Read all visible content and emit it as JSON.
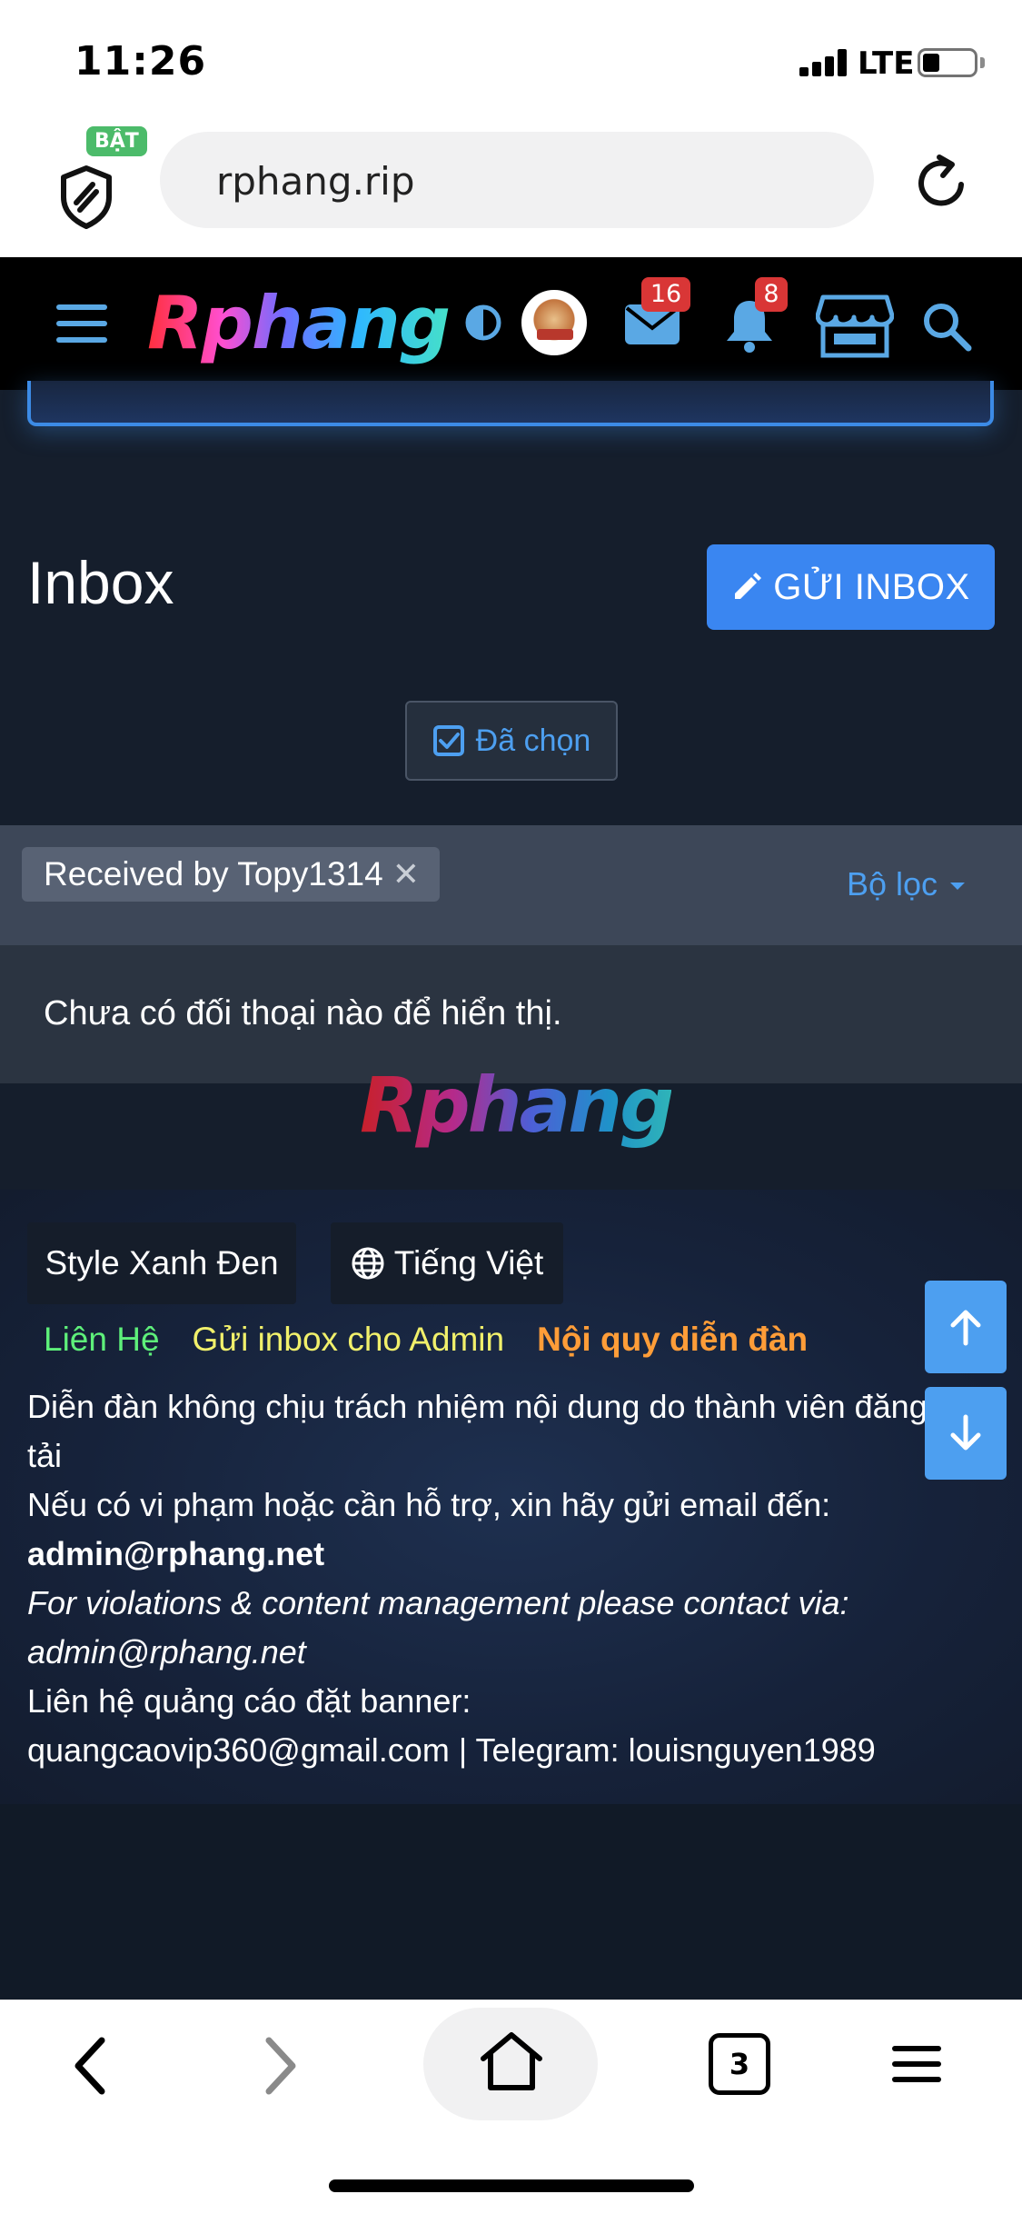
{
  "status_bar": {
    "time": "11:26",
    "network": "LTE"
  },
  "browser": {
    "shield_badge": "BẬT",
    "url": "rphang.rip",
    "tab_count": "3"
  },
  "site_header": {
    "logo_text": "Rphang",
    "mail_count": "16",
    "notification_count": "8"
  },
  "main": {
    "title": "Inbox",
    "send_button_label": "GỬI INBOX",
    "selected_button_label": "Đã chọn",
    "filter_chip_label": "Received by Topy1314",
    "filter_dropdown_label": "Bộ lọc",
    "empty_message": "Chưa có đối thoại nào để hiển thị.",
    "footer_logo_text": "Rphang"
  },
  "footer": {
    "style_label": "Style Xanh Đen",
    "language_label": "Tiếng Việt",
    "link_contact": "Liên Hệ",
    "link_admin": "Gửi inbox cho Admin",
    "link_rules": "Nội quy diễn đàn",
    "line1": "Diễn đàn không chịu trách nhiệm nội dung do thành viên đăng tải",
    "line2": "Nếu có vi phạm hoặc cần hỗ trợ, xin hãy gửi email đến:",
    "line3": "admin@rphang.net",
    "line4": "For violations & content management please contact via: admin@rphang.net",
    "line5": "Liên hệ quảng cáo đặt banner:",
    "line6": "quangcaovip360@gmail.com | Telegram: louisnguyen1989"
  },
  "colors": {
    "accent_blue": "#3a86f1",
    "link_blue": "#4d9ff0",
    "contact_green": "#5ef07a",
    "admin_yellow": "#f1f06b",
    "rules_orange": "#ff9d38",
    "badge_red": "#d93636"
  }
}
